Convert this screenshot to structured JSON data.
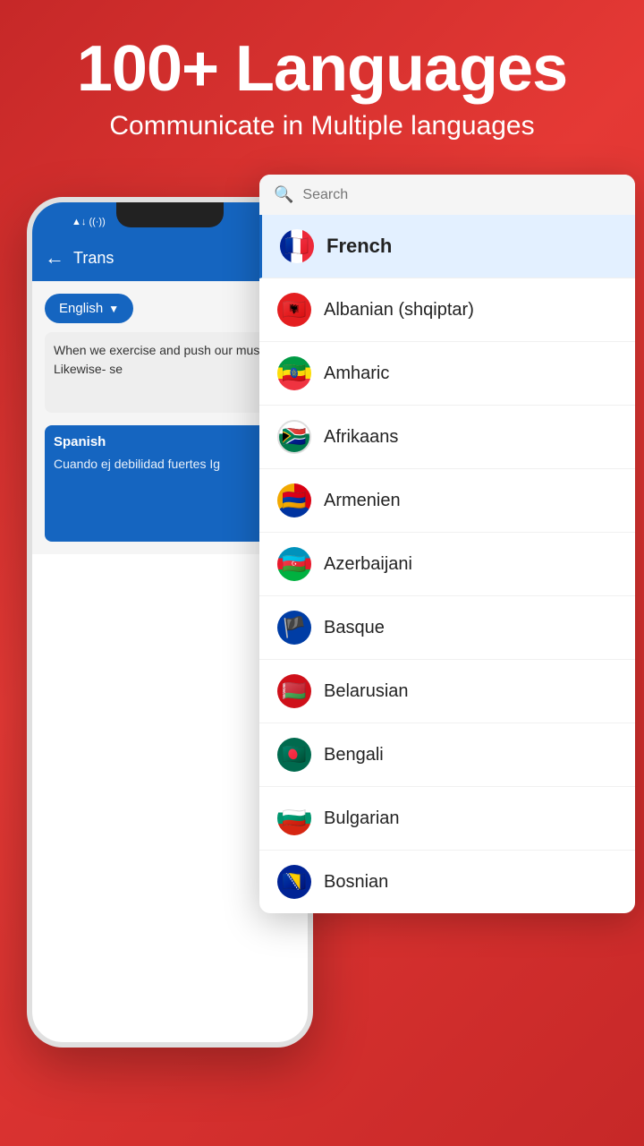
{
  "header": {
    "title": "100+ Languages",
    "subtitle": "Communicate in Multiple languages"
  },
  "phone": {
    "app_bar_title": "Trans",
    "source_lang": "English",
    "source_text": "When we exercise and push our muscles, Likewise- se",
    "target_lang": "Spanish",
    "target_text": "Cuando ej debilidad fuertes Ig"
  },
  "dropdown": {
    "search_placeholder": "Search",
    "selected_language": "French",
    "languages": [
      {
        "name": "French",
        "flag_class": "flag-fr",
        "emoji": "🇫🇷",
        "selected": true
      },
      {
        "name": "Albanian (shqiptar)",
        "flag_class": "flag-al",
        "emoji": "🇦🇱",
        "selected": false
      },
      {
        "name": "Amharic",
        "flag_class": "flag-am",
        "emoji": "🇪🇹",
        "selected": false
      },
      {
        "name": "Afrikaans",
        "flag_class": "flag-af",
        "emoji": "🇿🇦",
        "selected": false
      },
      {
        "name": "Armenien",
        "flag_class": "flag-arm",
        "emoji": "🇦🇲",
        "selected": false
      },
      {
        "name": "Azerbaijani",
        "flag_class": "flag-az",
        "emoji": "🇦🇿",
        "selected": false
      },
      {
        "name": "Basque",
        "flag_class": "flag-ba",
        "emoji": "🏴",
        "selected": false
      },
      {
        "name": "Belarusian",
        "flag_class": "flag-be",
        "emoji": "🇧🇾",
        "selected": false
      },
      {
        "name": "Bengali",
        "flag_class": "flag-bn",
        "emoji": "🇧🇩",
        "selected": false
      },
      {
        "name": "Bulgarian",
        "flag_class": "flag-bg",
        "emoji": "🇧🇬",
        "selected": false
      },
      {
        "name": "Bosnian",
        "flag_class": "flag-bs",
        "emoji": "🇧🇦",
        "selected": false
      }
    ]
  }
}
